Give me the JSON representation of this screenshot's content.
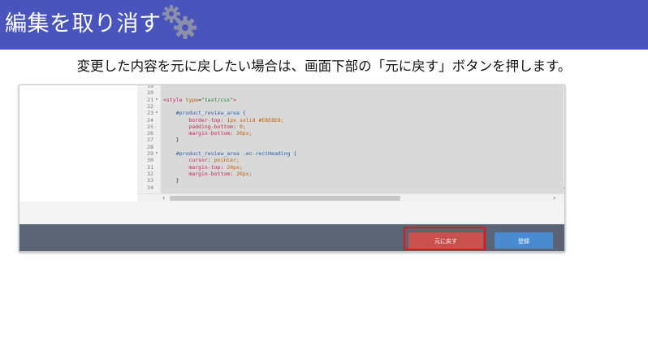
{
  "slide": {
    "title": "編集を取り消す",
    "instruction": "変更した内容を元に戻したい場合は、画面下部の「元に戻す」ボタンを押します。"
  },
  "editor": {
    "lines": [
      {
        "num": "19",
        "fold": "",
        "text": ""
      },
      {
        "num": "20",
        "fold": "",
        "text": ""
      },
      {
        "num": "21",
        "fold": "▾",
        "text": "<style type=\"text/css\">"
      },
      {
        "num": "22",
        "fold": "",
        "text": ""
      },
      {
        "num": "23",
        "fold": "▾",
        "text": "    #product_review_area {"
      },
      {
        "num": "24",
        "fold": "",
        "text": "        border-top: 1px solid #E8E8E8;"
      },
      {
        "num": "25",
        "fold": "",
        "text": "        padding-bottom: 0;"
      },
      {
        "num": "26",
        "fold": "",
        "text": "        margin-bottom: 20px;"
      },
      {
        "num": "27",
        "fold": "",
        "text": "    }"
      },
      {
        "num": "28",
        "fold": "",
        "text": ""
      },
      {
        "num": "29",
        "fold": "▾",
        "text": "    #product_review_area .ec-rectHeading {"
      },
      {
        "num": "30",
        "fold": "",
        "text": "        cursor: pointer;"
      },
      {
        "num": "31",
        "fold": "",
        "text": "        margin-top: 20px;"
      },
      {
        "num": "32",
        "fold": "",
        "text": "        margin-bottom: 20px;"
      },
      {
        "num": "33",
        "fold": "",
        "text": "    }"
      },
      {
        "num": "34",
        "fold": "",
        "text": ""
      }
    ]
  },
  "footer": {
    "revert_label": "元に戻す",
    "register_label": "登録"
  },
  "colors": {
    "title_bar": "#4a54bd",
    "revert_button": "#c9504d",
    "register_button": "#4a8ad1",
    "highlight_border": "#e8141c",
    "footer_bar": "#5b6475"
  },
  "icons": [
    "gears-icon",
    "fold-arrow-icon",
    "scroll-left-icon",
    "scroll-right-icon",
    "scroll-down-icon"
  ]
}
